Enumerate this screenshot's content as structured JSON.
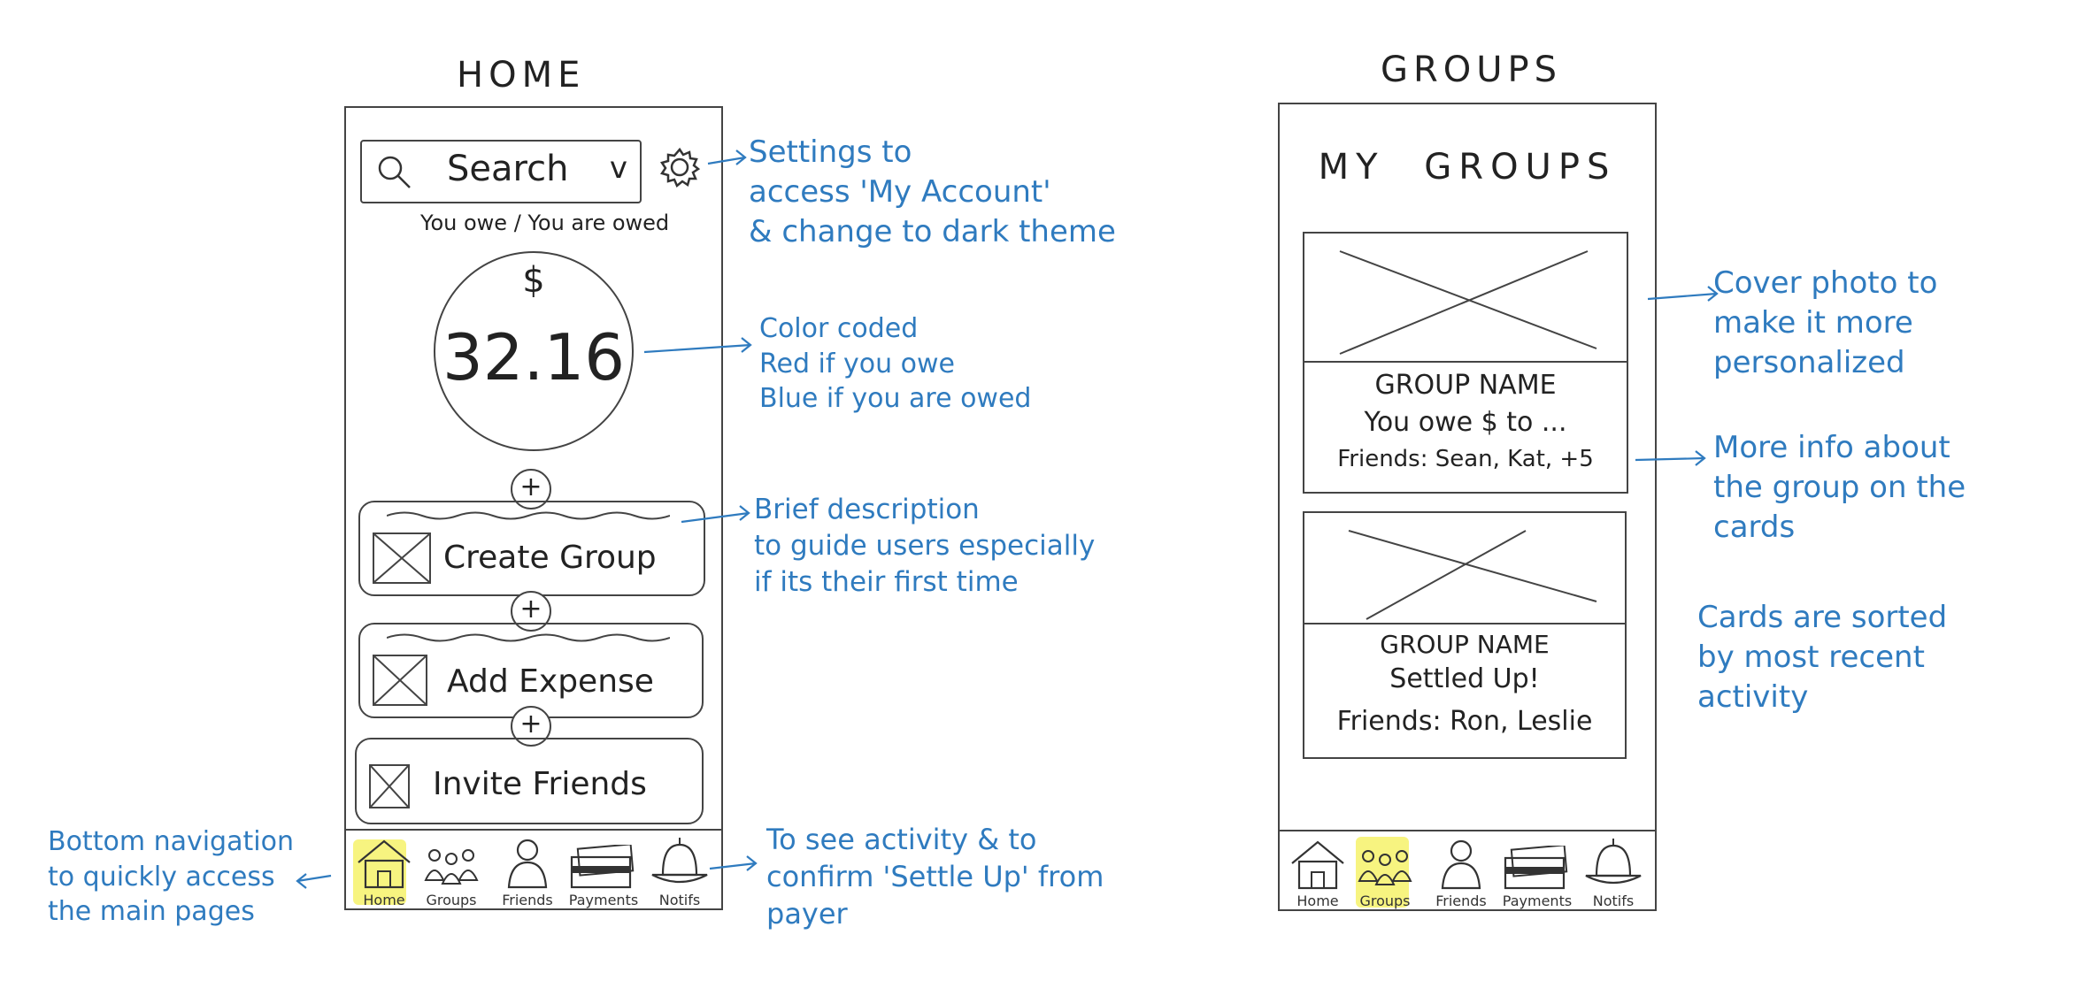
{
  "home_screen": {
    "title": "HOME",
    "search_label": "Search",
    "search_chevron": "v",
    "owe_toggle": "You owe / You are owed",
    "currency_symbol": "$",
    "balance": "32.16",
    "actions": [
      {
        "label": "Create Group",
        "icon": "image-placeholder-icon"
      },
      {
        "label": "Add Expense",
        "icon": "image-placeholder-icon"
      },
      {
        "label": "Invite Friends",
        "icon": "image-placeholder-icon"
      }
    ],
    "nav": [
      {
        "label": "Home",
        "icon": "home-icon"
      },
      {
        "label": "Groups",
        "icon": "groups-icon"
      },
      {
        "label": "Friends",
        "icon": "friend-icon"
      },
      {
        "label": "Payments",
        "icon": "wallet-icon"
      },
      {
        "label": "Notifs",
        "icon": "bell-icon"
      }
    ],
    "active_nav": "Home"
  },
  "groups_screen": {
    "title": "GROUPS",
    "heading": "MY GROUPS",
    "cards": [
      {
        "name": "GROUP NAME",
        "status": "You owe $ to ...",
        "friends": "Friends: Sean, Kat, +5"
      },
      {
        "name": "GROUP NAME",
        "status": "Settled Up!",
        "friends": "Friends: Ron, Leslie"
      }
    ],
    "nav": [
      {
        "label": "Home",
        "icon": "home-icon"
      },
      {
        "label": "Groups",
        "icon": "groups-icon"
      },
      {
        "label": "Friends",
        "icon": "friend-icon"
      },
      {
        "label": "Payments",
        "icon": "wallet-icon"
      },
      {
        "label": "Notifs",
        "icon": "bell-icon"
      }
    ],
    "active_nav": "Groups"
  },
  "annotations": {
    "settings": "Settings to\naccess 'My Account'\n& change to dark theme",
    "color_coded": "Color coded\nRed if you owe\nBlue if you are owed",
    "brief_description": "Brief description\nto guide users especially\nif its their first time",
    "bottom_navigation": "Bottom navigation\nto quickly access\nthe main pages",
    "notifs": "To see activity & to\nconfirm 'Settle Up' from\npayer",
    "cover_photo": "Cover photo to\nmake it more\npersonalized",
    "more_info": "More info about\nthe group on the\ncards",
    "sorted": "Cards are sorted\nby most recent\nactivity"
  },
  "colors": {
    "annotation_ink": "#2f7bbf",
    "sketch_ink": "#444444",
    "highlight": "#f6f26a"
  }
}
